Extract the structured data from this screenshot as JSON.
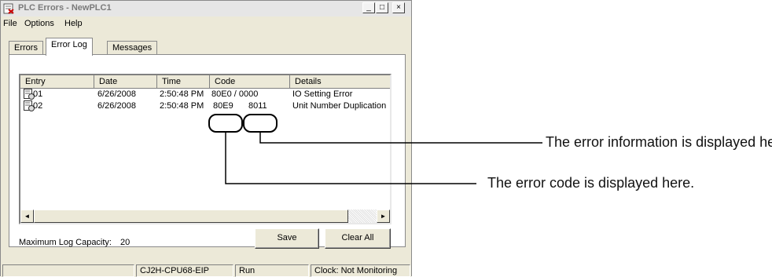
{
  "window": {
    "title": "PLC Errors - NewPLC1",
    "controls": [
      "_",
      "□",
      "×"
    ]
  },
  "menu": [
    "File",
    "Options",
    "Help"
  ],
  "tabs": {
    "errors": "Errors",
    "error_log": "Error Log",
    "messages": "Messages",
    "active": "Error Log"
  },
  "list": {
    "columns": [
      "Entry",
      "Date",
      "Time",
      "Code",
      "Details"
    ],
    "rows": [
      {
        "entry": "01",
        "date": "6/26/2008",
        "time": "2:50:48 PM",
        "code": "80E0 / 0000",
        "details": "IO Setting Error"
      },
      {
        "entry": "02",
        "date": "6/26/2008",
        "time": "2:50:48 PM",
        "code_main": "80E9",
        "code_sub": "8011",
        "details": "Unit Number Duplication"
      }
    ],
    "scroll_left": "◄",
    "scroll_right": "►"
  },
  "footer": {
    "capacity_label": "Maximum Log Capacity:",
    "capacity_value": "20",
    "save_label": "Save",
    "clear_label": "Clear All"
  },
  "status": {
    "pane1": "",
    "model": "CJ2H-CPU68-EIP",
    "mode": "Run",
    "clock": "Clock: Not Monitoring"
  },
  "annotations": {
    "info": "The error information is displayed here.",
    "code": "The error code is displayed here."
  },
  "colors": {
    "highlight_outline": "#000000",
    "window_face": "#ece9d8"
  }
}
